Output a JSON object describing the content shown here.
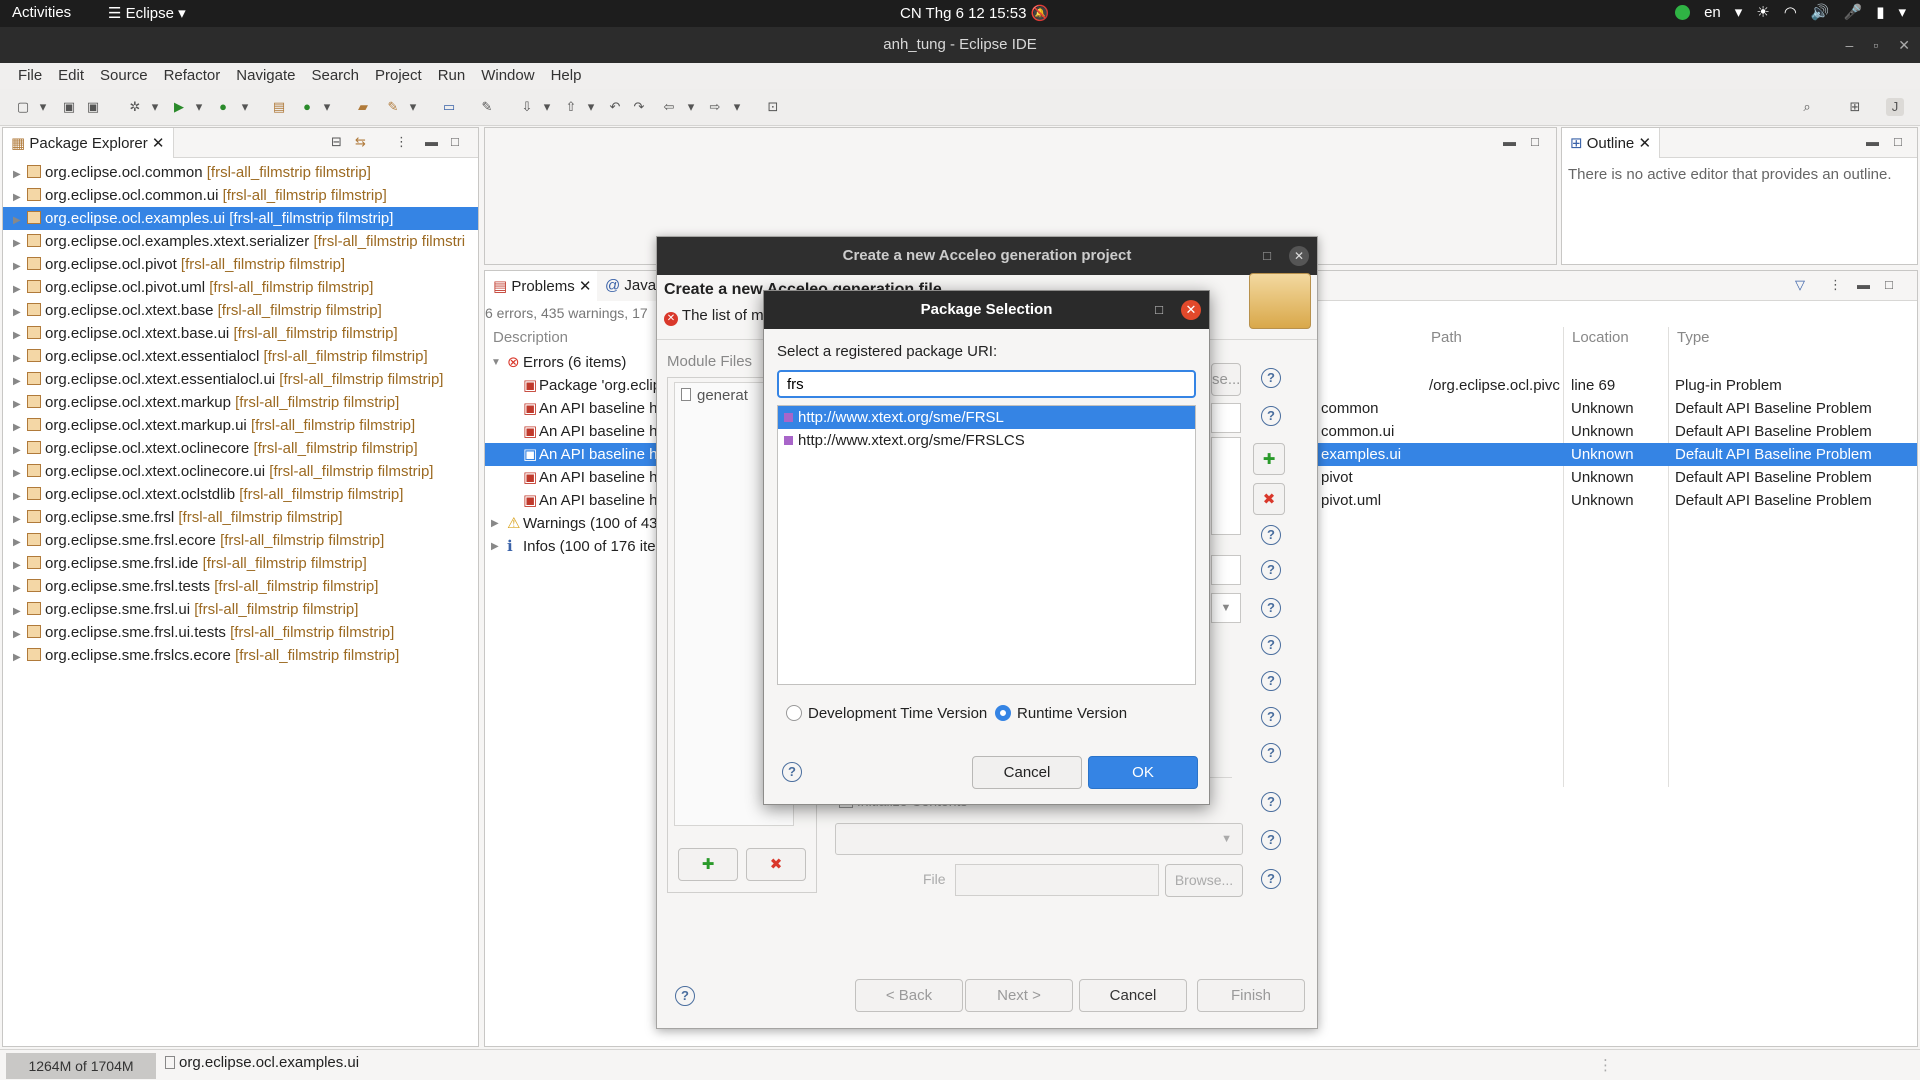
{
  "topbar": {
    "activities": "Activities",
    "app_menu": "Eclipse",
    "clock": "CN Thg 6 12  15:53",
    "lang": "en"
  },
  "window": {
    "title": "anh_tung - Eclipse IDE"
  },
  "menu": [
    "File",
    "Edit",
    "Source",
    "Refactor",
    "Navigate",
    "Search",
    "Project",
    "Run",
    "Window",
    "Help"
  ],
  "package_explorer": {
    "tab": "Package Explorer",
    "items": [
      {
        "name": "org.eclipse.ocl.common",
        "dec": "[frsl-all_filmstrip filmstrip]"
      },
      {
        "name": "org.eclipse.ocl.common.ui",
        "dec": "[frsl-all_filmstrip filmstrip]"
      },
      {
        "name": "org.eclipse.ocl.examples.ui",
        "dec": "[frsl-all_filmstrip filmstrip]"
      },
      {
        "name": "org.eclipse.ocl.examples.xtext.serializer",
        "dec": "[frsl-all_filmstrip filmstri"
      },
      {
        "name": "org.eclipse.ocl.pivot",
        "dec": "[frsl-all_filmstrip filmstrip]"
      },
      {
        "name": "org.eclipse.ocl.pivot.uml",
        "dec": "[frsl-all_filmstrip filmstrip]"
      },
      {
        "name": "org.eclipse.ocl.xtext.base",
        "dec": "[frsl-all_filmstrip filmstrip]"
      },
      {
        "name": "org.eclipse.ocl.xtext.base.ui",
        "dec": "[frsl-all_filmstrip filmstrip]"
      },
      {
        "name": "org.eclipse.ocl.xtext.essentialocl",
        "dec": "[frsl-all_filmstrip filmstrip]"
      },
      {
        "name": "org.eclipse.ocl.xtext.essentialocl.ui",
        "dec": "[frsl-all_filmstrip filmstrip]"
      },
      {
        "name": "org.eclipse.ocl.xtext.markup",
        "dec": "[frsl-all_filmstrip filmstrip]"
      },
      {
        "name": "org.eclipse.ocl.xtext.markup.ui",
        "dec": "[frsl-all_filmstrip filmstrip]"
      },
      {
        "name": "org.eclipse.ocl.xtext.oclinecore",
        "dec": "[frsl-all_filmstrip filmstrip]"
      },
      {
        "name": "org.eclipse.ocl.xtext.oclinecore.ui",
        "dec": "[frsl-all_filmstrip filmstrip]"
      },
      {
        "name": "org.eclipse.ocl.xtext.oclstdlib",
        "dec": "[frsl-all_filmstrip filmstrip]"
      },
      {
        "name": "org.eclipse.sme.frsl",
        "dec": "[frsl-all_filmstrip filmstrip]"
      },
      {
        "name": "org.eclipse.sme.frsl.ecore",
        "dec": "[frsl-all_filmstrip filmstrip]"
      },
      {
        "name": "org.eclipse.sme.frsl.ide",
        "dec": "[frsl-all_filmstrip filmstrip]"
      },
      {
        "name": "org.eclipse.sme.frsl.tests",
        "dec": "[frsl-all_filmstrip filmstrip]"
      },
      {
        "name": "org.eclipse.sme.frsl.ui",
        "dec": "[frsl-all_filmstrip filmstrip]"
      },
      {
        "name": "org.eclipse.sme.frsl.ui.tests",
        "dec": "[frsl-all_filmstrip filmstrip]"
      },
      {
        "name": "org.eclipse.sme.frslcs.ecore",
        "dec": "[frsl-all_filmstrip filmstrip]"
      }
    ],
    "selected_index": 2
  },
  "outline": {
    "tab": "Outline",
    "message": "There is no active editor that provides an outline."
  },
  "problems": {
    "tab": "Problems",
    "tab2": "Javad",
    "summary": "6 errors, 435 warnings, 17",
    "cols": {
      "description": "Description",
      "path": "Path",
      "location": "Location",
      "type": "Type"
    },
    "errors_group": "Errors (6 items)",
    "warnings_group": "Warnings (100 of 435",
    "infos_group": "Infos (100 of 176 ite",
    "rows": [
      {
        "desc": "Package 'org.eclip",
        "resource": "",
        "path": "/org.eclipse.ocl.pivc",
        "location": "line 69",
        "type": "Plug-in Problem"
      },
      {
        "desc": "An API baseline ha",
        "resource": "common",
        "path": "",
        "location": "Unknown",
        "type": "Default API Baseline Problem"
      },
      {
        "desc": "An API baseline ha",
        "resource": "common.ui",
        "path": "",
        "location": "Unknown",
        "type": "Default API Baseline Problem"
      },
      {
        "desc": "An API baseline ha",
        "resource": "examples.ui",
        "path": "",
        "location": "Unknown",
        "type": "Default API Baseline Problem"
      },
      {
        "desc": "An API baseline ha",
        "resource": "pivot",
        "path": "",
        "location": "Unknown",
        "type": "Default API Baseline Problem"
      },
      {
        "desc": "An API baseline ha",
        "resource": "pivot.uml",
        "path": "",
        "location": "Unknown",
        "type": "Default API Baseline Problem"
      }
    ]
  },
  "wizard": {
    "title": "Create a new Acceleo generation project",
    "subtitle": "Create a new Acceleo generation file",
    "error": "The list of m",
    "module_files": "Module Files",
    "module_item": "generat",
    "browse_partial": "se...",
    "init_contents": "Initialize Contents",
    "file_label": "File",
    "browse": "Browse...",
    "back": "< Back",
    "next": "Next >",
    "cancel": "Cancel",
    "finish": "Finish"
  },
  "pkg_dialog": {
    "title": "Package Selection",
    "prompt": "Select a registered package URI:",
    "filter": "frs",
    "uris": [
      "http://www.xtext.org/sme/FRSL",
      "http://www.xtext.org/sme/FRSLCS"
    ],
    "radio_dev": "Development Time Version",
    "radio_runtime": "Runtime Version",
    "cancel": "Cancel",
    "ok": "OK"
  },
  "status": {
    "heap": "1264M of 1704M",
    "selection": "org.eclipse.ocl.examples.ui"
  },
  "colors": {
    "selection": "#3584e4",
    "decoration": "#9c6a22"
  }
}
